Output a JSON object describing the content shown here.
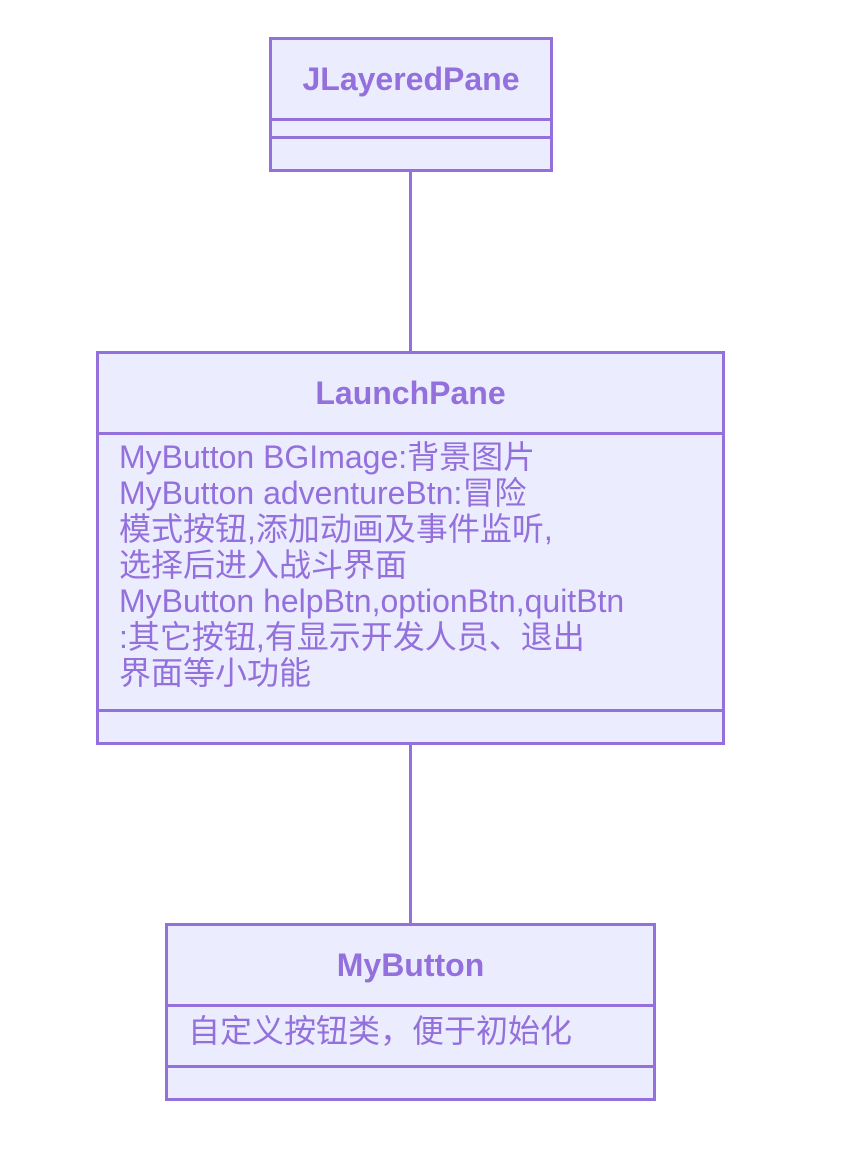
{
  "classes": {
    "jlayeredpane": {
      "name": "JLayeredPane",
      "attributes": [],
      "methods": []
    },
    "launchpane": {
      "name": "LaunchPane",
      "attributes": [
        "MyButton BGImage:背景图片",
        "MyButton adventureBtn:冒险",
        "模式按钮,添加动画及事件监听,",
        "选择后进入战斗界面",
        "MyButton helpBtn,optionBtn,quitBtn",
        ":其它按钮,有显示开发人员、退出",
        "界面等小功能"
      ],
      "methods": []
    },
    "mybutton": {
      "name": "MyButton",
      "attributes": [
        "自定义按钮类，便于初始化"
      ],
      "methods": []
    }
  },
  "relations": [
    {
      "from": "JLayeredPane",
      "to": "LaunchPane",
      "type": "association"
    },
    {
      "from": "LaunchPane",
      "to": "MyButton",
      "type": "association"
    }
  ],
  "colors": {
    "fill": "#ECECFF",
    "stroke": "#9370DB",
    "text": "#9370DB"
  }
}
